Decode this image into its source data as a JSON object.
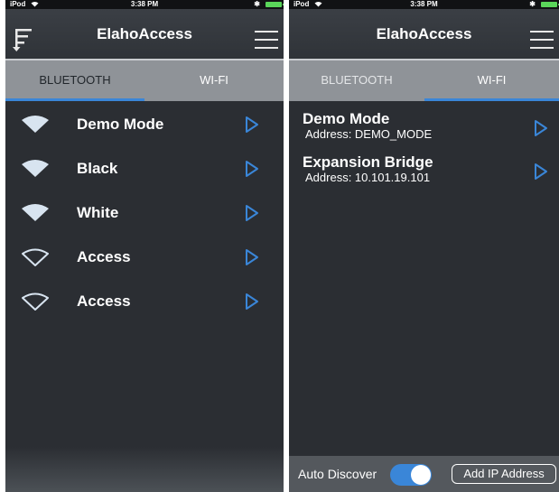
{
  "status_bar": {
    "carrier": "iPod",
    "time": "3:38 PM"
  },
  "app": {
    "title": "ElahoAccess"
  },
  "tabs": {
    "bluetooth": "BLUETOOTH",
    "wifi": "WI-FI"
  },
  "bluetooth_devices": [
    {
      "name": "Demo Mode",
      "signal": "strong"
    },
    {
      "name": "Black",
      "signal": "strong"
    },
    {
      "name": "White",
      "signal": "strong"
    },
    {
      "name": "Access",
      "signal": "weak"
    },
    {
      "name": "Access",
      "signal": "weak"
    }
  ],
  "wifi_devices": [
    {
      "name": "Demo Mode",
      "address": "Address: DEMO_MODE"
    },
    {
      "name": "Expansion Bridge",
      "address": "Address: 10.101.19.101"
    }
  ],
  "footer": {
    "auto_discover_label": "Auto Discover",
    "auto_discover_on": true,
    "add_ip_label": "Add IP Address"
  },
  "colors": {
    "accent": "#3a86d8",
    "background": "#2b2e33",
    "tab_bar": "#8f9398"
  }
}
